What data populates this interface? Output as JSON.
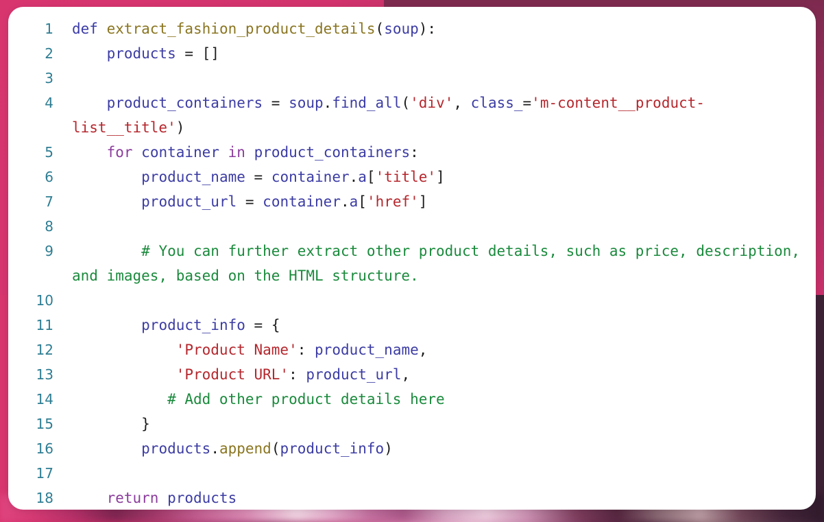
{
  "card": {
    "name": "python-code-snippet-card",
    "language": "python",
    "background_color": "#ffffff",
    "corner_radius_px": 22
  },
  "backdrop": {
    "accent_color": "#d8356f",
    "secondary_color": "#8f3364",
    "description": "blurred pink photographic background"
  },
  "theme": {
    "gutter_color": "#2e7d92",
    "keyword_color": "#8b3c9c",
    "def_keyword_color": "#3b3ba8",
    "function_name_color": "#8a7520",
    "variable_color": "#3c3ca4",
    "string_color": "#b5272d",
    "comment_color": "#1a8a3c",
    "punctuation_color": "#1b1b1b"
  },
  "code": {
    "lines": [
      {
        "number": "1",
        "tokens": [
          {
            "t": "def",
            "c": "def"
          },
          {
            "t": " ",
            "c": "plain"
          },
          {
            "t": "extract_fashion_product_details",
            "c": "fname"
          },
          {
            "t": "(",
            "c": "punct"
          },
          {
            "t": "soup",
            "c": "var"
          },
          {
            "t": "):",
            "c": "punct"
          }
        ]
      },
      {
        "number": "2",
        "tokens": [
          {
            "t": "    ",
            "c": "plain"
          },
          {
            "t": "products",
            "c": "var"
          },
          {
            "t": " = ",
            "c": "punct"
          },
          {
            "t": "[]",
            "c": "punct"
          }
        ]
      },
      {
        "number": "3",
        "tokens": []
      },
      {
        "number": "4",
        "tokens": [
          {
            "t": "    ",
            "c": "plain"
          },
          {
            "t": "product_containers",
            "c": "var"
          },
          {
            "t": " = ",
            "c": "punct"
          },
          {
            "t": "soup",
            "c": "var"
          },
          {
            "t": ".",
            "c": "punct"
          },
          {
            "t": "find_all",
            "c": "var"
          },
          {
            "t": "(",
            "c": "punct"
          },
          {
            "t": "'div'",
            "c": "str"
          },
          {
            "t": ", ",
            "c": "punct"
          },
          {
            "t": "class_",
            "c": "var"
          },
          {
            "t": "=",
            "c": "punct"
          },
          {
            "t": "'m-content__product-list__title'",
            "c": "str"
          },
          {
            "t": ")",
            "c": "punct"
          }
        ]
      },
      {
        "number": "5",
        "tokens": [
          {
            "t": "    ",
            "c": "plain"
          },
          {
            "t": "for",
            "c": "kw"
          },
          {
            "t": " ",
            "c": "plain"
          },
          {
            "t": "container",
            "c": "var"
          },
          {
            "t": " ",
            "c": "plain"
          },
          {
            "t": "in",
            "c": "kw"
          },
          {
            "t": " ",
            "c": "plain"
          },
          {
            "t": "product_containers",
            "c": "var"
          },
          {
            "t": ":",
            "c": "punct"
          }
        ]
      },
      {
        "number": "6",
        "tokens": [
          {
            "t": "        ",
            "c": "plain"
          },
          {
            "t": "product_name",
            "c": "var"
          },
          {
            "t": " = ",
            "c": "punct"
          },
          {
            "t": "container",
            "c": "var"
          },
          {
            "t": ".",
            "c": "punct"
          },
          {
            "t": "a",
            "c": "var"
          },
          {
            "t": "[",
            "c": "punct"
          },
          {
            "t": "'title'",
            "c": "str"
          },
          {
            "t": "]",
            "c": "punct"
          }
        ]
      },
      {
        "number": "7",
        "tokens": [
          {
            "t": "        ",
            "c": "plain"
          },
          {
            "t": "product_url",
            "c": "var"
          },
          {
            "t": " = ",
            "c": "punct"
          },
          {
            "t": "container",
            "c": "var"
          },
          {
            "t": ".",
            "c": "punct"
          },
          {
            "t": "a",
            "c": "var"
          },
          {
            "t": "[",
            "c": "punct"
          },
          {
            "t": "'href'",
            "c": "str"
          },
          {
            "t": "]",
            "c": "punct"
          }
        ]
      },
      {
        "number": "8",
        "tokens": []
      },
      {
        "number": "9",
        "tokens": [
          {
            "t": "        ",
            "c": "plain"
          },
          {
            "t": "# You can further extract other product details, such as price, description, and images, based on the HTML structure.",
            "c": "com"
          }
        ]
      },
      {
        "number": "10",
        "tokens": []
      },
      {
        "number": "11",
        "tokens": [
          {
            "t": "        ",
            "c": "plain"
          },
          {
            "t": "product_info",
            "c": "var"
          },
          {
            "t": " = ",
            "c": "punct"
          },
          {
            "t": "{",
            "c": "punct"
          }
        ]
      },
      {
        "number": "12",
        "tokens": [
          {
            "t": "            ",
            "c": "plain"
          },
          {
            "t": "'Product Name'",
            "c": "str"
          },
          {
            "t": ": ",
            "c": "punct"
          },
          {
            "t": "product_name",
            "c": "var"
          },
          {
            "t": ",",
            "c": "punct"
          }
        ]
      },
      {
        "number": "13",
        "tokens": [
          {
            "t": "            ",
            "c": "plain"
          },
          {
            "t": "'Product URL'",
            "c": "str"
          },
          {
            "t": ": ",
            "c": "punct"
          },
          {
            "t": "product_url",
            "c": "var"
          },
          {
            "t": ",",
            "c": "punct"
          }
        ]
      },
      {
        "number": "14",
        "tokens": [
          {
            "t": "           ",
            "c": "plain"
          },
          {
            "t": "# Add other product details here",
            "c": "com"
          }
        ]
      },
      {
        "number": "15",
        "tokens": [
          {
            "t": "        ",
            "c": "plain"
          },
          {
            "t": "}",
            "c": "punct"
          }
        ]
      },
      {
        "number": "16",
        "tokens": [
          {
            "t": "        ",
            "c": "plain"
          },
          {
            "t": "products",
            "c": "var"
          },
          {
            "t": ".",
            "c": "punct"
          },
          {
            "t": "append",
            "c": "fname"
          },
          {
            "t": "(",
            "c": "punct"
          },
          {
            "t": "product_info",
            "c": "var"
          },
          {
            "t": ")",
            "c": "punct"
          }
        ]
      },
      {
        "number": "17",
        "tokens": []
      },
      {
        "number": "18",
        "tokens": [
          {
            "t": "    ",
            "c": "plain"
          },
          {
            "t": "return",
            "c": "kw"
          },
          {
            "t": " ",
            "c": "plain"
          },
          {
            "t": "products",
            "c": "var"
          }
        ]
      }
    ]
  }
}
